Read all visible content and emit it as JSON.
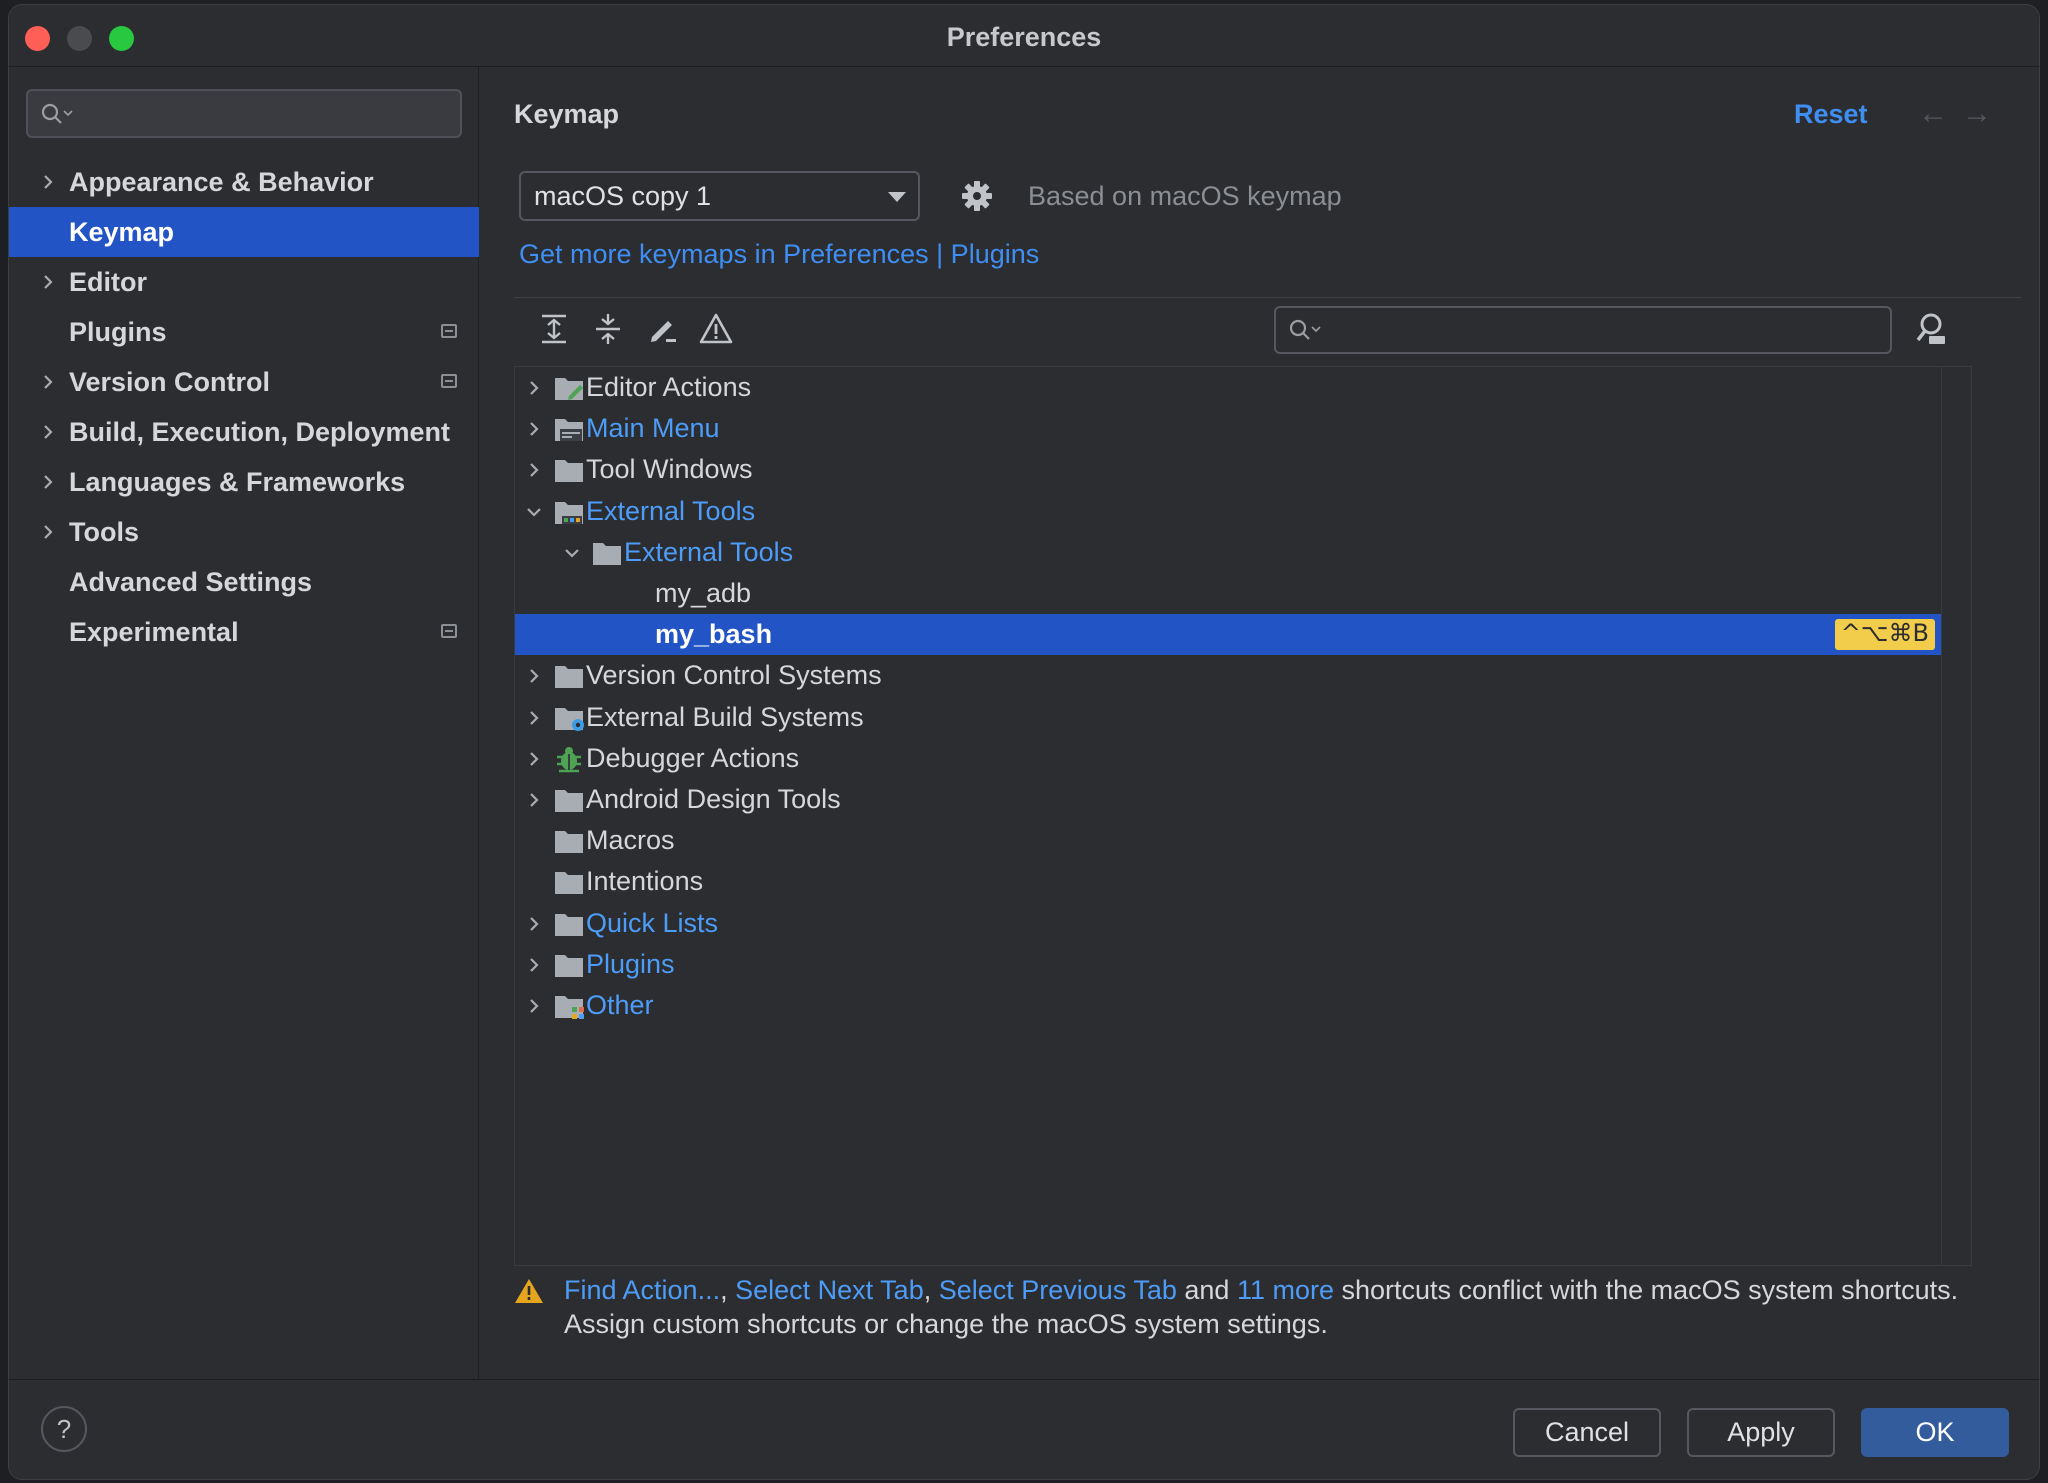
{
  "window": {
    "title": "Preferences"
  },
  "sidebar": {
    "search_placeholder": "",
    "items": [
      {
        "label": "Appearance & Behavior",
        "has_chevron": true,
        "badge": false,
        "active": false
      },
      {
        "label": "Keymap",
        "has_chevron": false,
        "badge": false,
        "active": true
      },
      {
        "label": "Editor",
        "has_chevron": true,
        "badge": false,
        "active": false
      },
      {
        "label": "Plugins",
        "has_chevron": false,
        "badge": true,
        "active": false
      },
      {
        "label": "Version Control",
        "has_chevron": true,
        "badge": true,
        "active": false
      },
      {
        "label": "Build, Execution, Deployment",
        "has_chevron": true,
        "badge": false,
        "active": false
      },
      {
        "label": "Languages & Frameworks",
        "has_chevron": true,
        "badge": false,
        "active": false
      },
      {
        "label": "Tools",
        "has_chevron": true,
        "badge": false,
        "active": false
      },
      {
        "label": "Advanced Settings",
        "has_chevron": false,
        "badge": false,
        "active": false
      },
      {
        "label": "Experimental",
        "has_chevron": false,
        "badge": true,
        "active": false
      }
    ]
  },
  "header": {
    "title": "Keymap",
    "reset_label": "Reset",
    "back_glyph": "←",
    "forward_glyph": "→"
  },
  "keymap": {
    "selected": "macOS copy 1",
    "based_on": "Based on macOS keymap",
    "more_link": "Get more keymaps in Preferences | Plugins"
  },
  "toolbar": {
    "icons": [
      "expand-all-icon",
      "collapse-all-icon",
      "edit-shortcut-icon",
      "conflicts-warning-icon"
    ],
    "search_placeholder": ""
  },
  "tree": {
    "rows": [
      {
        "label": "Editor Actions",
        "level": 0,
        "chevron": "right",
        "blue": false,
        "icon": "folder-edit"
      },
      {
        "label": "Main Menu",
        "level": 0,
        "chevron": "right",
        "blue": true,
        "icon": "folder-menu"
      },
      {
        "label": "Tool Windows",
        "level": 0,
        "chevron": "right",
        "blue": false,
        "icon": "folder"
      },
      {
        "label": "External Tools",
        "level": 0,
        "chevron": "down",
        "blue": true,
        "icon": "folder-tools"
      },
      {
        "label": "External Tools",
        "level": 1,
        "chevron": "down",
        "blue": true,
        "icon": "folder"
      },
      {
        "label": "my_adb",
        "level": 2,
        "chevron": "none",
        "blue": false,
        "icon": "none"
      },
      {
        "label": "my_bash",
        "level": 2,
        "chevron": "none",
        "blue": false,
        "icon": "none",
        "selected": true,
        "shortcut": "^⌥⌘B"
      },
      {
        "label": "Version Control Systems",
        "level": 0,
        "chevron": "right",
        "blue": false,
        "icon": "folder"
      },
      {
        "label": "External Build Systems",
        "level": 0,
        "chevron": "right",
        "blue": false,
        "icon": "folder-gear"
      },
      {
        "label": "Debugger Actions",
        "level": 0,
        "chevron": "right",
        "blue": false,
        "icon": "bug"
      },
      {
        "label": "Android Design Tools",
        "level": 0,
        "chevron": "right",
        "blue": false,
        "icon": "folder"
      },
      {
        "label": "Macros",
        "level": 0,
        "chevron": "none",
        "blue": false,
        "icon": "folder"
      },
      {
        "label": "Intentions",
        "level": 0,
        "chevron": "none",
        "blue": false,
        "icon": "folder"
      },
      {
        "label": "Quick Lists",
        "level": 0,
        "chevron": "right",
        "blue": true,
        "icon": "folder"
      },
      {
        "label": "Plugins",
        "level": 0,
        "chevron": "right",
        "blue": true,
        "icon": "folder"
      },
      {
        "label": "Other",
        "level": 0,
        "chevron": "right",
        "blue": true,
        "icon": "folder-other"
      }
    ]
  },
  "warning": {
    "link1": "Find Action...",
    "sep1": ", ",
    "link2": "Select Next Tab",
    "sep2": ", ",
    "link3": "Select Previous Tab",
    "and": " and ",
    "link4": "11 more",
    "rest": " shortcuts conflict with the macOS system shortcuts.",
    "line2": "Assign custom shortcuts or change the macOS system settings."
  },
  "footer": {
    "help": "?",
    "cancel": "Cancel",
    "apply": "Apply",
    "ok": "OK"
  },
  "colors": {
    "accent": "#2254c5",
    "link": "#3f8ef3",
    "shortcut_bg": "#f1cd4b"
  }
}
